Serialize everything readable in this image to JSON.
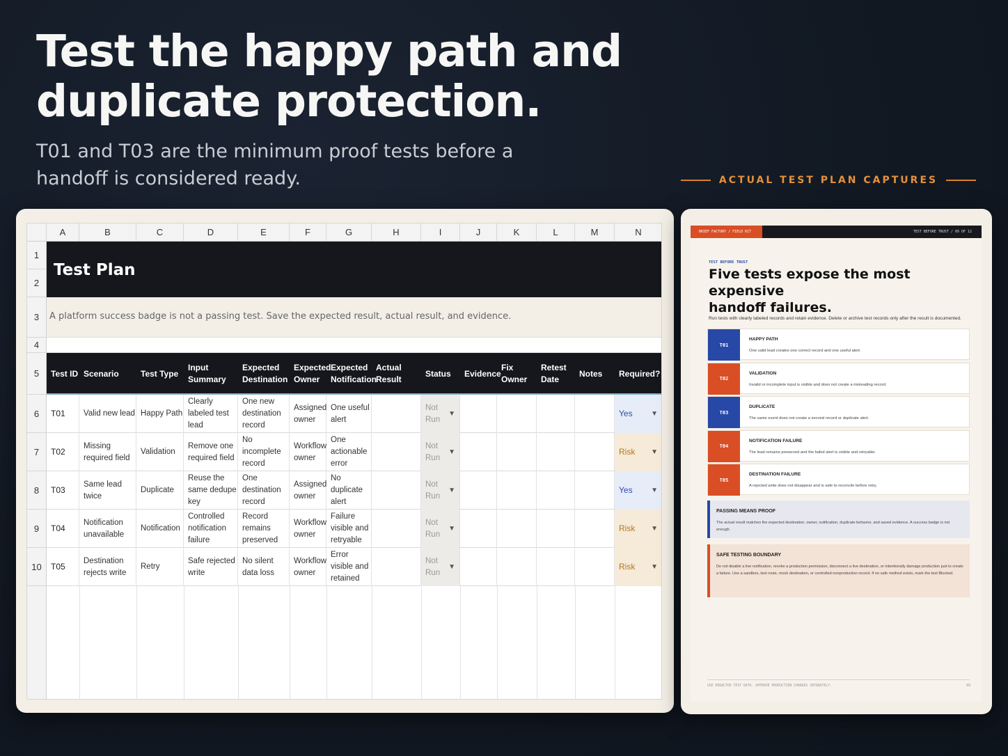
{
  "hero": {
    "headline_line1": "Test the happy path and",
    "headline_line2": "duplicate protection.",
    "subhead_line1": "T01 and T03 are the minimum proof tests before a",
    "subhead_line2": "handoff is considered ready.",
    "captures_label": "ACTUAL TEST PLAN CAPTURES"
  },
  "sheet": {
    "column_letters": [
      "A",
      "B",
      "C",
      "D",
      "E",
      "F",
      "G",
      "H",
      "I",
      "J",
      "K",
      "L",
      "M",
      "N"
    ],
    "row_numbers": [
      "1",
      "2",
      "3",
      "4",
      "5",
      "6",
      "7",
      "8",
      "9",
      "10"
    ],
    "title": "Test Plan",
    "note": "A platform success badge is not a passing test. Save the expected result, actual result, and evidence.",
    "headers": [
      "Test ID",
      "Scenario",
      "Test Type",
      "Input Summary",
      "Expected Destination",
      "Expected Owner",
      "Expected Notification",
      "Actual Result",
      "Status",
      "Evidence",
      "Fix Owner",
      "Retest Date",
      "Notes",
      "Required?"
    ],
    "rows": [
      {
        "id": "T01",
        "scenario": "Valid new lead",
        "type": "Happy Path",
        "input": "Clearly labeled test lead",
        "destination": "One new destination record",
        "owner": "Assigned owner",
        "notification": "One useful alert",
        "status": "Not Run",
        "required": "Yes"
      },
      {
        "id": "T02",
        "scenario": "Missing required field",
        "type": "Validation",
        "input": "Remove one required field",
        "destination": "No incomplete record",
        "owner": "Workflow owner",
        "notification": "One actionable error",
        "status": "Not Run",
        "required": "Risk"
      },
      {
        "id": "T03",
        "scenario": "Same lead twice",
        "type": "Duplicate",
        "input": "Reuse the same dedupe key",
        "destination": "One destination record",
        "owner": "Assigned owner",
        "notification": "No duplicate alert",
        "status": "Not Run",
        "required": "Yes"
      },
      {
        "id": "T04",
        "scenario": "Notification unavailable",
        "type": "Notification",
        "input": "Controlled notification failure",
        "destination": "Record remains preserved",
        "owner": "Workflow owner",
        "notification": "Failure visible and retryable",
        "status": "Not Run",
        "required": "Risk"
      },
      {
        "id": "T05",
        "scenario": "Destination rejects write",
        "type": "Retry",
        "input": "Safe rejected write",
        "destination": "No silent data loss",
        "owner": "Workflow owner",
        "notification": "Error visible and retained",
        "status": "Not Run",
        "required": "Risk"
      }
    ]
  },
  "doc": {
    "tag": "BRIEF FACTORY / FIELD KIT",
    "top_right": "TEST BEFORE TRUST  /  09 OF 12",
    "eyebrow": "TEST BEFORE TRUST",
    "title_line1": "Five tests expose the most expensive",
    "title_line2": "handoff failures.",
    "intro": "Run tests with clearly labeled records and retain evidence. Delete or archive test records only after the result is documented.",
    "tests": [
      {
        "code": "T01",
        "name": "HAPPY PATH",
        "desc": "One valid lead creates one correct record and one useful alert.",
        "color": "blue"
      },
      {
        "code": "T02",
        "name": "VALIDATION",
        "desc": "Invalid or incomplete input is visible and does not create a misleading record.",
        "color": "orange"
      },
      {
        "code": "T03",
        "name": "DUPLICATE",
        "desc": "The same event does not create a second record or duplicate alert.",
        "color": "blue"
      },
      {
        "code": "T04",
        "name": "NOTIFICATION FAILURE",
        "desc": "The lead remains preserved and the failed alert is visible and retryable.",
        "color": "orange"
      },
      {
        "code": "T05",
        "name": "DESTINATION FAILURE",
        "desc": "A rejected write does not disappear and is safe to reconcile before retry.",
        "color": "orange"
      }
    ],
    "proof_title": "PASSING MEANS PROOF",
    "proof_body": "The actual result matches the expected destination, owner, notification, duplicate behavior, and saved evidence. A success badge is not enough.",
    "boundary_title": "SAFE TESTING BOUNDARY",
    "boundary_body": "Do not disable a live notification, revoke a production permission, disconnect a live destination, or intentionally damage production just to create a failure. Use a sandbox, test route, mock destination, or controlled nonproduction record. If no safe method exists, mark the test Blocked.",
    "footer": "USE REDACTED TEST DATA. APPROVE PRODUCTION CHANGES SEPARATELY.",
    "page_num": "09",
    "colors": {
      "blue": "#2748a6",
      "orange": "#d94e25",
      "proof_bg": "#e7e8ef",
      "boundary_bg": "#f3e2d6"
    }
  }
}
